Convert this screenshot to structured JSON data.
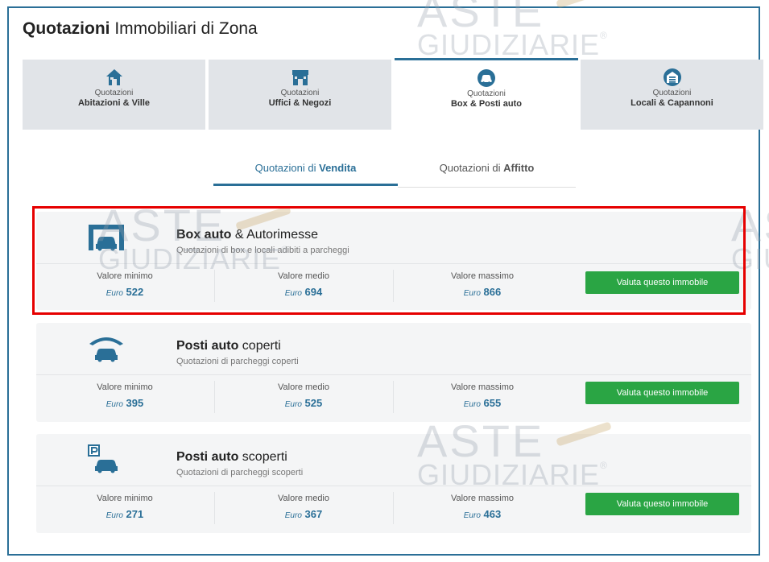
{
  "header": {
    "title_bold": "Quotazioni",
    "title_rest": " Immobiliari di Zona"
  },
  "tabs": [
    {
      "line1": "Quotazioni",
      "line2": "Abitazioni & Ville",
      "icon": "house-icon",
      "active": false
    },
    {
      "line1": "Quotazioni",
      "line2": "Uffici & Negozi",
      "icon": "shop-icon",
      "active": false
    },
    {
      "line1": "Quotazioni",
      "line2": "Box & Posti auto",
      "icon": "car-icon",
      "active": true
    },
    {
      "line1": "Quotazioni",
      "line2": "Locali & Capannoni",
      "icon": "warehouse-icon",
      "active": false
    }
  ],
  "subtabs": {
    "sale": {
      "prefix": "Quotazioni di ",
      "bold": "Vendita"
    },
    "rent": {
      "prefix": "Quotazioni di ",
      "bold": "Affitto"
    }
  },
  "cards": [
    {
      "title_bold": "Box auto",
      "title_rest": " & Autorimesse",
      "subtitle": "Quotazioni di box e locali adibiti a parcheggi",
      "icon": "garage-icon",
      "highlighted": true,
      "min_label": "Valore minimo",
      "min_currency": "Euro",
      "min_value": "522",
      "mid_label": "Valore medio",
      "mid_currency": "Euro",
      "mid_value": "694",
      "max_label": "Valore massimo",
      "max_currency": "Euro",
      "max_value": "866",
      "button": "Valuta questo immobile"
    },
    {
      "title_bold": "Posti auto",
      "title_rest": " coperti",
      "subtitle": "Quotazioni di parcheggi coperti",
      "icon": "covered-parking-icon",
      "highlighted": false,
      "min_label": "Valore minimo",
      "min_currency": "Euro",
      "min_value": "395",
      "mid_label": "Valore medio",
      "mid_currency": "Euro",
      "mid_value": "525",
      "max_label": "Valore massimo",
      "max_currency": "Euro",
      "max_value": "655",
      "button": "Valuta questo immobile"
    },
    {
      "title_bold": "Posti auto",
      "title_rest": " scoperti",
      "subtitle": "Quotazioni di parcheggi scoperti",
      "icon": "open-parking-icon",
      "highlighted": false,
      "min_label": "Valore minimo",
      "min_currency": "Euro",
      "min_value": "271",
      "mid_label": "Valore medio",
      "mid_currency": "Euro",
      "mid_value": "367",
      "max_label": "Valore massimo",
      "max_currency": "Euro",
      "max_value": "463",
      "button": "Valuta questo immobile"
    }
  ],
  "watermark": {
    "line1": "ASTE",
    "line2": "GIUDIZIARIE",
    "mark": "®"
  },
  "colors": {
    "accent": "#2a6f97",
    "button": "#2aa544",
    "highlight": "#e60000",
    "tab_bg": "#e1e4e8"
  }
}
